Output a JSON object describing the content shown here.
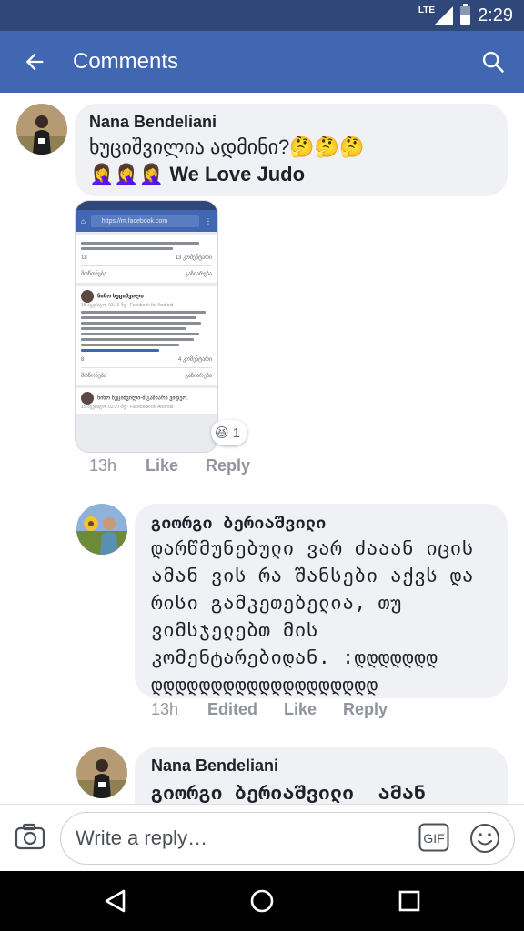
{
  "status_bar": {
    "network": "LTE",
    "time": "2:29"
  },
  "app_bar": {
    "title": "Comments"
  },
  "comments": [
    {
      "author": "Nana Bendeliani",
      "text_line1": "ხუციშვილია ადმინი?🤔🤔🤔",
      "text_line2_emoji": "🤦‍♀️🤦‍♀️🤦‍♀️",
      "text_line2": "We Love Judo",
      "time": "13h",
      "like": "Like",
      "reply": "Reply",
      "reaction_emoji": "😆",
      "reaction_count": "1",
      "attachment": {
        "url": "https://m.facebook.com",
        "top_count": "18",
        "top_comments": "13 კომენტარი",
        "like_label": "მოწონება",
        "share_label": "გაზიარება",
        "post_author": "ნინო ხუციშვილი",
        "post_meta": "15 აგვისტო, 03:16-ზე · Facebook for Android",
        "reactions_count": "8",
        "comments_count": "4 კომენტარი",
        "share_author": "ნინო ხუციშვილი-მ გაზიარა ვიდეო.",
        "share_meta": "15 აგვისტო, 02:27-ზე · Facebook for Android"
      }
    },
    {
      "author": "გიორგი ბერიაშვილი",
      "lines": [
        "დარწმუნებული ვარ ძააან იცის",
        "ამან ვის რა შანსები აქვს და",
        "რისი გამკეთებელია, თუ",
        "ვიმსჯელებთ მის",
        "კომენტარებიდან. :დდდდდდდ",
        "დდდდდდდდდდდდდდდდდდდ"
      ],
      "time": "13h",
      "edited": "Edited",
      "like": "Like",
      "reply": "Reply"
    },
    {
      "author": "Nana Bendeliani",
      "text": "გიორგი ბერიაშვილი  ამან"
    }
  ],
  "composer": {
    "placeholder": "Write a reply…",
    "gif_label": "GIF"
  },
  "colors": {
    "app_bar": "#4267b2",
    "status_bar": "#2f4779",
    "bubble": "#f0f1f4"
  }
}
